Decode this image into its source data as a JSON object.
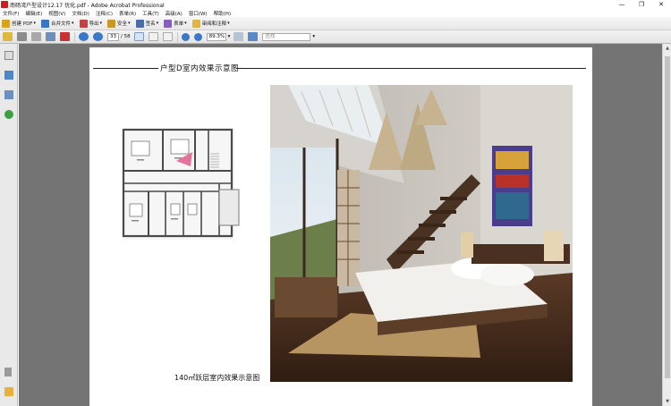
{
  "window": {
    "title": "南砀湾户型设计12.17 优化.pdf - Adobe Acrobat Professional",
    "controls": [
      "—",
      "❐",
      "✕"
    ]
  },
  "menu": [
    "文件(F)",
    "编辑(E)",
    "视图(V)",
    "文档(D)",
    "注释(C)",
    "表单(R)",
    "工具(T)",
    "高级(A)",
    "窗口(W)",
    "帮助(H)"
  ],
  "toolbar": {
    "create_pdf": "创建 PDF",
    "combine": "合并文件",
    "export": "导出",
    "secure": "安全",
    "sign": "签名",
    "forms": "表单",
    "review": "审阅和注释"
  },
  "nav": {
    "page_current": "33",
    "page_total": "/ 58",
    "zoom": "89.3%",
    "search_placeholder": "查找"
  },
  "document": {
    "section_title": "户型D室内效果示意图",
    "caption": "140㎡跃层室内效果示意图"
  },
  "colors": {
    "doc_background": "#747474",
    "page": "#ffffff",
    "accent_pink": "#e05a8a"
  }
}
